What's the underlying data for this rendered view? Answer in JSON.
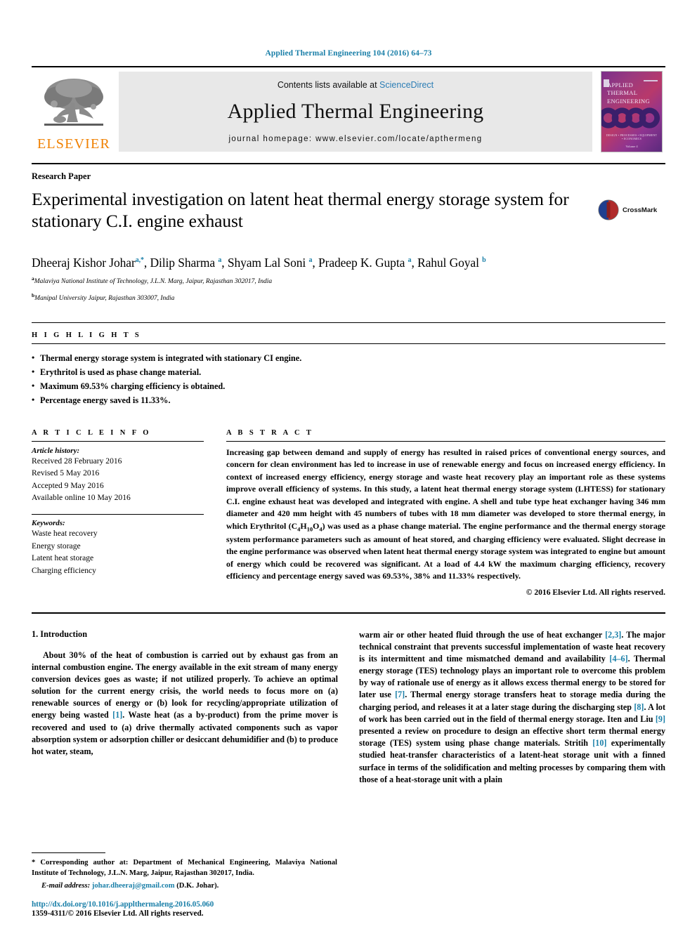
{
  "running_head": "Applied Thermal Engineering 104 (2016) 64–73",
  "masthead": {
    "publisher_name": "ELSEVIER",
    "contents_prefix": "Contents lists available at ",
    "contents_link": "ScienceDirect",
    "journal_title": "Applied Thermal Engineering",
    "homepage": "journal homepage: www.elsevier.com/locate/apthermeng",
    "cover": {
      "line1": "APPLIED",
      "line2": "THERMAL",
      "line3": "ENGINEERING",
      "bottom_tagline": "DESIGN • PROCESSES • EQUIPMENT • ECONOMICS",
      "volume": "Volume 4"
    }
  },
  "article": {
    "kind": "Research Paper",
    "title": "Experimental investigation on latent heat thermal energy storage system for stationary C.I. engine exhaust",
    "crossmark_label": "CrossMark",
    "authors": [
      {
        "name": "Dheeraj Kishor Johar",
        "marks": "a,*"
      },
      {
        "name": "Dilip Sharma",
        "marks": "a"
      },
      {
        "name": "Shyam Lal Soni",
        "marks": "a"
      },
      {
        "name": "Pradeep K. Gupta",
        "marks": "a"
      },
      {
        "name": "Rahul Goyal",
        "marks": "b"
      }
    ],
    "affiliations": [
      {
        "mark": "a",
        "text": "Malaviya National Institute of Technology, J.L.N. Marg, Jaipur, Rajasthan 302017, India"
      },
      {
        "mark": "b",
        "text": "Manipal University Jaipur, Rajasthan 303007, India"
      }
    ]
  },
  "highlights": {
    "heading": "H I G H L I G H T S",
    "items": [
      "Thermal energy storage system is integrated with stationary CI engine.",
      "Erythritol is used as phase change material.",
      "Maximum 69.53% charging efficiency is obtained.",
      "Percentage energy saved is 11.33%."
    ]
  },
  "article_info": {
    "heading": "A R T I C L E  I N F O",
    "history_label": "Article history:",
    "history": [
      "Received 28 February 2016",
      "Revised 5 May 2016",
      "Accepted 9 May 2016",
      "Available online 10 May 2016"
    ],
    "keywords_label": "Keywords:",
    "keywords": [
      "Waste heat recovery",
      "Energy storage",
      "Latent heat storage",
      "Charging efficiency"
    ]
  },
  "abstract": {
    "heading": "A B S T R A C T",
    "part1": "Increasing gap between demand and supply of energy has resulted in raised prices of conventional energy sources, and concern for clean environment has led to increase in use of renewable energy and focus on increased energy efficiency. In context of increased energy efficiency, energy storage and waste heat recovery play an important role as these systems improve overall efficiency of systems. In this study, a latent heat thermal energy storage system (LHTESS) for stationary C.I. engine exhaust heat was developed and integrated with engine. A shell and tube type heat exchanger having 346 mm diameter and 420 mm height with 45 numbers of tubes with 18 mm diameter was developed to store thermal energy, in which Erythritol (C",
    "sub1": "4",
    "mid1": "H",
    "sub2": "10",
    "mid2": "O",
    "sub3": "4",
    "part2": ") was used as a phase change material. The engine performance and the thermal energy storage system performance parameters such as amount of heat stored, and charging efficiency were evaluated. Slight decrease in the engine performance was observed when latent heat thermal energy storage system was integrated to engine but amount of energy which could be recovered was significant. At a load of 4.4 kW the maximum charging efficiency, recovery efficiency and percentage energy saved was 69.53%, 38% and 11.33% respectively.",
    "copyright": "© 2016 Elsevier Ltd. All rights reserved."
  },
  "body": {
    "section_title": "1. Introduction",
    "left_para_1": "About 30% of the heat of combustion is carried out by exhaust gas from an internal combustion engine. The energy available in the exit stream of many energy conversion devices goes as waste; if not utilized properly. To achieve an optimal solution for the current energy crisis, the world needs to focus more on (a) renewable sources of energy or (b) look for recycling/appropriate utilization of energy being wasted ",
    "ref_1": "[1]",
    "left_para_1b": ". Waste heat (as a by-product) from the prime mover is recovered and used to (a) drive thermally activated components such as vapor absorption system or adsorption chiller or desiccant dehumidifier and (b) to produce hot water, steam,",
    "right_1": "warm air or other heated fluid through the use of heat exchanger ",
    "ref_2": "[2,3]",
    "right_2": ". The major technical constraint that prevents successful implementation of waste heat recovery is its intermittent and time mismatched demand and availability ",
    "ref_3": "[4–6]",
    "right_4": ". Thermal energy storage (TES) technology plays an important role to overcome this problem by way of rationale use of energy as it allows excess thermal energy to be stored for later use ",
    "ref_4": "[7]",
    "right_5": ". Thermal energy storage transfers heat to storage media during the charging period, and releases it at a later stage during the discharging step ",
    "ref_5": "[8]",
    "right_6": ". A lot of work has been carried out in the field of thermal energy storage. Iten and Liu ",
    "ref_6": "[9]",
    "right_7": " presented a review on procedure to design an effective short term thermal energy storage (TES) system using phase change materials. Stritih ",
    "ref_7": "[10]",
    "right_8": " experimentally studied heat-transfer characteristics of a latent-heat storage unit with a finned surface in terms of the solidification and melting processes by comparing them with those of a heat-storage unit with a plain"
  },
  "footnote": {
    "corresponding": "* Corresponding author at: Department of Mechanical Engineering, Malaviya National Institute of Technology, J.L.N. Marg, Jaipur, Rajasthan 302017, India.",
    "email_label": "E-mail address:",
    "email": "johar.dheeraj@gmail.com",
    "email_owner": "(D.K. Johar)."
  },
  "doi": {
    "url": "http://dx.doi.org/10.1016/j.applthermaleng.2016.05.060",
    "issn": "1359-4311/© 2016 Elsevier Ltd. All rights reserved."
  },
  "colors": {
    "link": "#1a7fa8",
    "elsevier_orange": "#f08000",
    "sciencedirect": "#2b7db5"
  }
}
